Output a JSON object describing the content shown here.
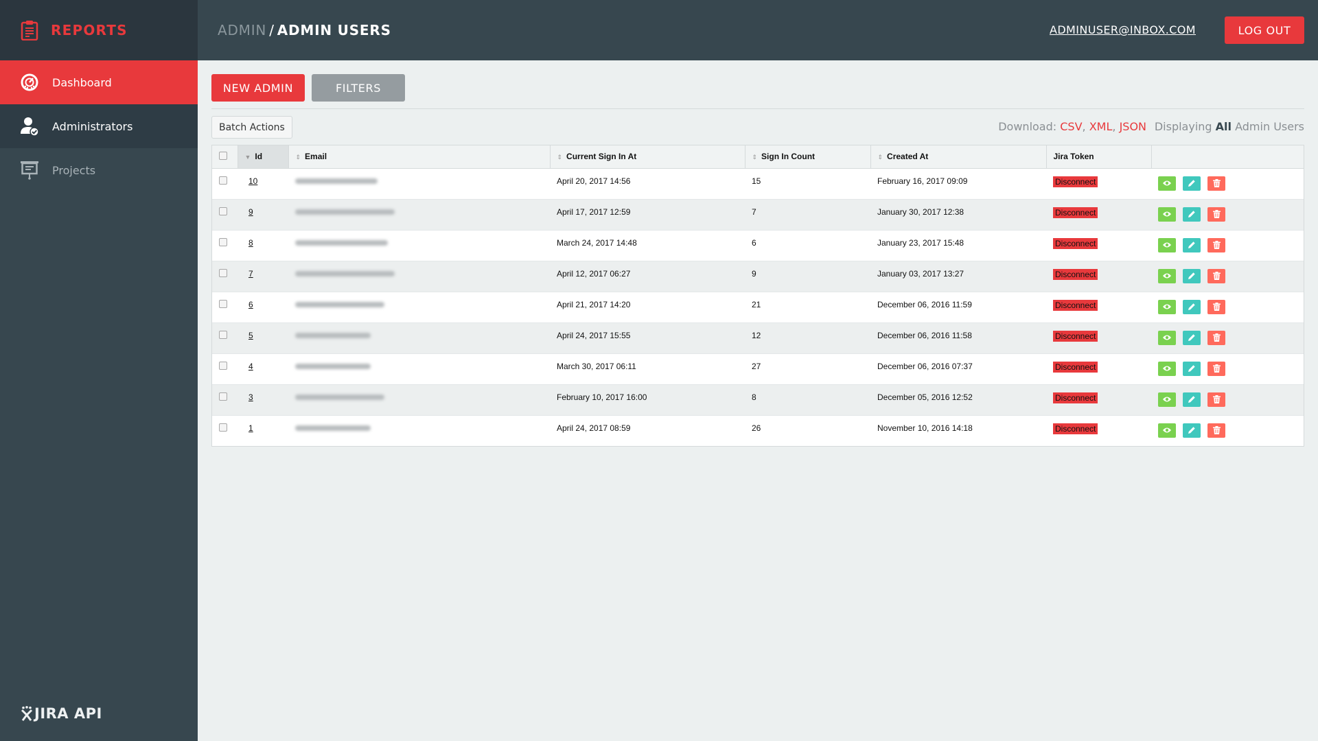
{
  "sidebar": {
    "brand": "REPORTS",
    "brand_icon": "clipboard-icon",
    "items": [
      {
        "label": "Dashboard",
        "icon": "speedometer-icon",
        "active": true
      },
      {
        "label": "Administrators",
        "icon": "user-check-icon",
        "active": false
      },
      {
        "label": "Projects",
        "icon": "presentation-board-icon",
        "active": false
      }
    ],
    "footer": "JIRA API"
  },
  "header": {
    "breadcrumb_root": "ADMIN",
    "breadcrumb_sep": "/",
    "breadcrumb_current": "ADMIN USERS",
    "user_email": "ADMINUSER@INBOX.COM",
    "logout_label": "LOG OUT"
  },
  "toolbar": {
    "new_admin_label": "NEW ADMIN",
    "filters_label": "FILTERS",
    "batch_actions_label": "Batch Actions",
    "download_label": "Download:",
    "download_formats": [
      "CSV",
      "XML",
      "JSON"
    ],
    "displaying_prefix": "Displaying",
    "displaying_scope": "All",
    "displaying_suffix": "Admin Users"
  },
  "table": {
    "columns": [
      "Id",
      "Email",
      "Current Sign In At",
      "Sign In Count",
      "Created At",
      "Jira Token"
    ],
    "sorted_column": "Id",
    "token_action_label": "Disconnect",
    "row_actions": [
      "view",
      "edit",
      "delete"
    ],
    "colors": {
      "view": "#7ad14f",
      "edit": "#40c8bd",
      "delete": "#ff6a5c",
      "accent": "#e8393c"
    },
    "rows": [
      {
        "id": "10",
        "email": "",
        "current_sign_in_at": "April 20, 2017 14:56",
        "sign_in_count": "15",
        "created_at": "February 16, 2017 09:09"
      },
      {
        "id": "9",
        "email": "",
        "current_sign_in_at": "April 17, 2017 12:59",
        "sign_in_count": "7",
        "created_at": "January 30, 2017 12:38"
      },
      {
        "id": "8",
        "email": "",
        "current_sign_in_at": "March 24, 2017 14:48",
        "sign_in_count": "6",
        "created_at": "January 23, 2017 15:48"
      },
      {
        "id": "7",
        "email": "",
        "current_sign_in_at": "April 12, 2017 06:27",
        "sign_in_count": "9",
        "created_at": "January 03, 2017 13:27"
      },
      {
        "id": "6",
        "email": "",
        "current_sign_in_at": "April 21, 2017 14:20",
        "sign_in_count": "21",
        "created_at": "December 06, 2016 11:59"
      },
      {
        "id": "5",
        "email": "",
        "current_sign_in_at": "April 24, 2017 15:55",
        "sign_in_count": "12",
        "created_at": "December 06, 2016 11:58"
      },
      {
        "id": "4",
        "email": "",
        "current_sign_in_at": "March 30, 2017 06:11",
        "sign_in_count": "27",
        "created_at": "December 06, 2016 07:37"
      },
      {
        "id": "3",
        "email": "",
        "current_sign_in_at": "February 10, 2017 16:00",
        "sign_in_count": "8",
        "created_at": "December 05, 2016 12:52"
      },
      {
        "id": "1",
        "email": "",
        "current_sign_in_at": "April 24, 2017 08:59",
        "sign_in_count": "26",
        "created_at": "November 10, 2016 14:18"
      }
    ]
  }
}
